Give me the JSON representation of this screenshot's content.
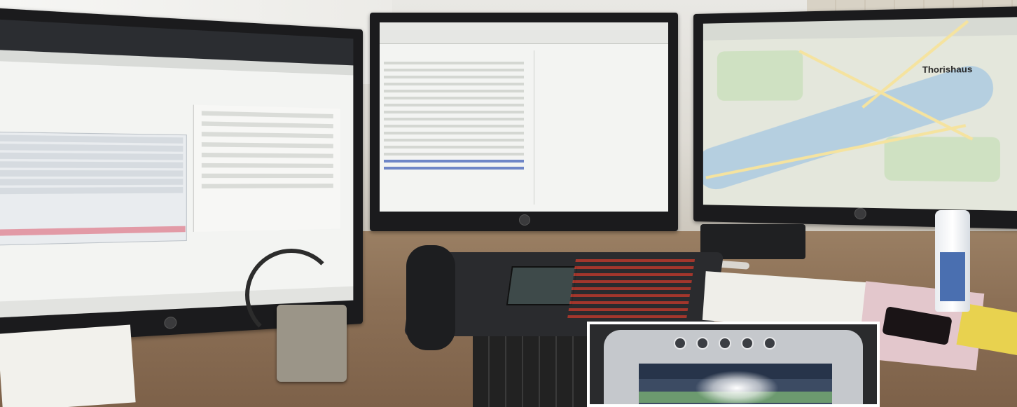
{
  "scene": {
    "description_items": [
      "left-monitor",
      "center-monitor",
      "right-monitor",
      "desk-phone",
      "headset",
      "keyboard",
      "tablet-inset"
    ]
  },
  "right_monitor": {
    "map_label": "Thorishaus"
  },
  "colors": {
    "desk": "#8c7056",
    "monitor_bezel": "#1b1b1d",
    "map_water": "#b5cfe0",
    "map_park": "#cfe1c2",
    "map_road": "#f5e39f",
    "phone_keys_accent": "#c0392b"
  }
}
